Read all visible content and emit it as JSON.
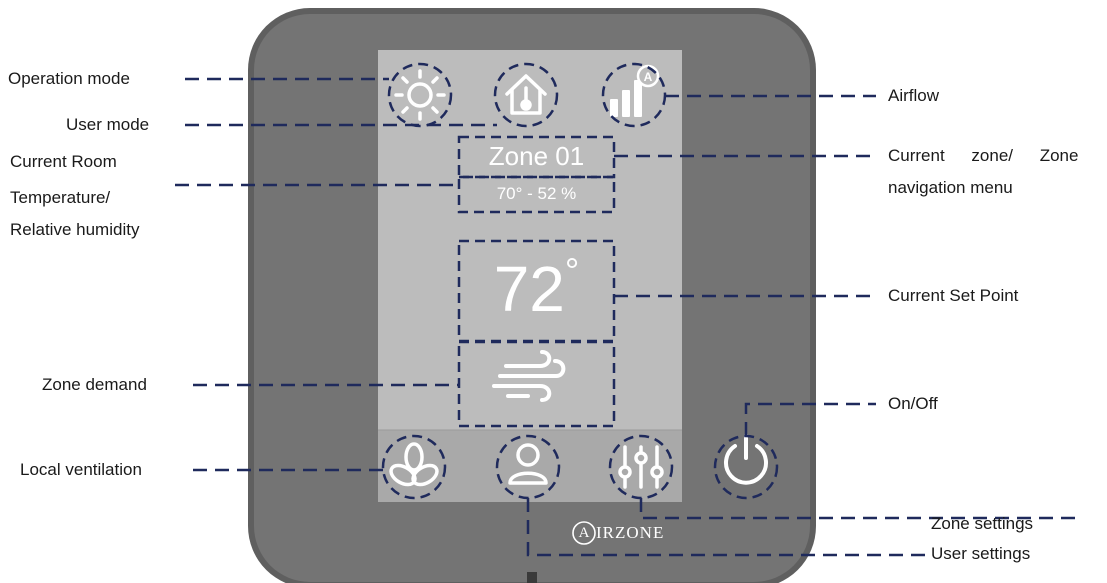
{
  "device": {
    "zone_name": "Zone 01",
    "room_reading": "70° - 52 %",
    "set_point": "72",
    "set_point_degree": "°",
    "brand": "IRZONE",
    "brand_initial": "A",
    "colors": {
      "bezel": "#6f6f6f",
      "screen": "#b9b9b9",
      "bottom_bar": "#a6a6a6",
      "callout_line": "#1f2a5c"
    }
  },
  "buttons_top": [
    {
      "name": "operation-mode-button",
      "icon": "sun-icon"
    },
    {
      "name": "user-mode-button",
      "icon": "home-thermometer-icon"
    },
    {
      "name": "airflow-button",
      "icon": "signal-bars-auto-icon",
      "badge": "A"
    }
  ],
  "buttons_bottom": [
    {
      "name": "local-ventilation-button",
      "icon": "fan-icon"
    },
    {
      "name": "user-settings-button",
      "icon": "user-icon"
    },
    {
      "name": "zone-settings-button",
      "icon": "sliders-icon"
    },
    {
      "name": "power-button",
      "icon": "power-icon"
    }
  ],
  "callouts": {
    "operation_mode": "Operation mode",
    "user_mode": "User mode",
    "current_room_line1": "Current Room",
    "current_room_line2": "Temperature/",
    "current_room_line3": "Relative humidity",
    "zone_demand": "Zone demand",
    "local_ventilation": "Local ventilation",
    "airflow": "Airflow",
    "current_zone_line1": "Current zone/ Zone",
    "current_zone_line2": "navigation menu",
    "current_set_point": "Current Set Point",
    "on_off": "On/Off",
    "zone_settings": "Zone settings",
    "user_settings": "User settings"
  }
}
